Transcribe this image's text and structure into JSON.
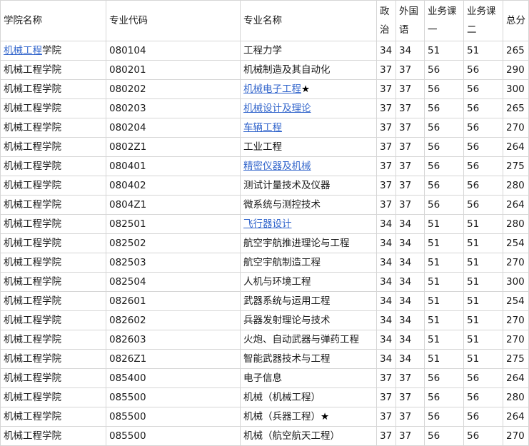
{
  "headers": {
    "college": "学院名称",
    "code": "专业代码",
    "major": "专业名称",
    "politics": "政治",
    "foreign": "外国语",
    "course1": "业务课一",
    "course2": "业务课二",
    "total": "总分"
  },
  "rows": [
    {
      "college": "机械工程",
      "college_suffix": "学院",
      "college_link": true,
      "code": "080104",
      "major": "工程力学",
      "major_link": false,
      "star": "",
      "politics": "34",
      "foreign": "34",
      "course1": "51",
      "course2": "51",
      "total": "265"
    },
    {
      "college": "机械工程学院",
      "college_suffix": "",
      "college_link": false,
      "code": "080201",
      "major": "机械制造及其自动化",
      "major_link": false,
      "star": "",
      "politics": "37",
      "foreign": "37",
      "course1": "56",
      "course2": "56",
      "total": "290"
    },
    {
      "college": "机械工程学院",
      "college_suffix": "",
      "college_link": false,
      "code": "080202",
      "major": "机械电子工程",
      "major_link": true,
      "star": "★",
      "politics": "37",
      "foreign": "37",
      "course1": "56",
      "course2": "56",
      "total": "300"
    },
    {
      "college": "机械工程学院",
      "college_suffix": "",
      "college_link": false,
      "code": "080203",
      "major": "机械设计及理论",
      "major_link": true,
      "star": "",
      "politics": "37",
      "foreign": "37",
      "course1": "56",
      "course2": "56",
      "total": "265"
    },
    {
      "college": "机械工程学院",
      "college_suffix": "",
      "college_link": false,
      "code": "080204",
      "major": "车辆工程",
      "major_link": true,
      "star": "",
      "politics": "37",
      "foreign": "37",
      "course1": "56",
      "course2": "56",
      "total": "270"
    },
    {
      "college": "机械工程学院",
      "college_suffix": "",
      "college_link": false,
      "code": "0802Z1",
      "major": "工业工程",
      "major_link": false,
      "star": "",
      "politics": "37",
      "foreign": "37",
      "course1": "56",
      "course2": "56",
      "total": "264"
    },
    {
      "college": "机械工程学院",
      "college_suffix": "",
      "college_link": false,
      "code": "080401",
      "major": "精密仪器及机械",
      "major_link": true,
      "star": "",
      "politics": "37",
      "foreign": "37",
      "course1": "56",
      "course2": "56",
      "total": "275"
    },
    {
      "college": "机械工程学院",
      "college_suffix": "",
      "college_link": false,
      "code": "080402",
      "major": "测试计量技术及仪器",
      "major_link": false,
      "star": "",
      "politics": "37",
      "foreign": "37",
      "course1": "56",
      "course2": "56",
      "total": "280"
    },
    {
      "college": "机械工程学院",
      "college_suffix": "",
      "college_link": false,
      "code": "0804Z1",
      "major": "微系统与测控技术",
      "major_link": false,
      "star": "",
      "politics": "37",
      "foreign": "37",
      "course1": "56",
      "course2": "56",
      "total": "264"
    },
    {
      "college": "机械工程学院",
      "college_suffix": "",
      "college_link": false,
      "code": "082501",
      "major": "飞行器设计",
      "major_link": true,
      "star": "",
      "politics": "34",
      "foreign": "34",
      "course1": "51",
      "course2": "51",
      "total": "280"
    },
    {
      "college": "机械工程学院",
      "college_suffix": "",
      "college_link": false,
      "code": "082502",
      "major": "航空宇航推进理论与工程",
      "major_link": false,
      "star": "",
      "politics": "34",
      "foreign": "34",
      "course1": "51",
      "course2": "51",
      "total": "254"
    },
    {
      "college": "机械工程学院",
      "college_suffix": "",
      "college_link": false,
      "code": "082503",
      "major": "航空宇航制造工程",
      "major_link": false,
      "star": "",
      "politics": "34",
      "foreign": "34",
      "course1": "51",
      "course2": "51",
      "total": "270"
    },
    {
      "college": "机械工程学院",
      "college_suffix": "",
      "college_link": false,
      "code": "082504",
      "major": "人机与环境工程",
      "major_link": false,
      "star": "",
      "politics": "34",
      "foreign": "34",
      "course1": "51",
      "course2": "51",
      "total": "300"
    },
    {
      "college": "机械工程学院",
      "college_suffix": "",
      "college_link": false,
      "code": "082601",
      "major": "武器系统与运用工程",
      "major_link": false,
      "star": "",
      "politics": "34",
      "foreign": "34",
      "course1": "51",
      "course2": "51",
      "total": "254"
    },
    {
      "college": "机械工程学院",
      "college_suffix": "",
      "college_link": false,
      "code": "082602",
      "major": "兵器发射理论与技术",
      "major_link": false,
      "star": "",
      "politics": "34",
      "foreign": "34",
      "course1": "51",
      "course2": "51",
      "total": "270"
    },
    {
      "college": "机械工程学院",
      "college_suffix": "",
      "college_link": false,
      "code": "082603",
      "major": "火炮、自动武器与弹药工程",
      "major_link": false,
      "star": "",
      "politics": "34",
      "foreign": "34",
      "course1": "51",
      "course2": "51",
      "total": "270"
    },
    {
      "college": "机械工程学院",
      "college_suffix": "",
      "college_link": false,
      "code": "0826Z1",
      "major": "智能武器技术与工程",
      "major_link": false,
      "star": "",
      "politics": "34",
      "foreign": "34",
      "course1": "51",
      "course2": "51",
      "total": "275"
    },
    {
      "college": "机械工程学院",
      "college_suffix": "",
      "college_link": false,
      "code": "085400",
      "major": "电子信息",
      "major_link": false,
      "star": "",
      "politics": "37",
      "foreign": "37",
      "course1": "56",
      "course2": "56",
      "total": "264"
    },
    {
      "college": "机械工程学院",
      "college_suffix": "",
      "college_link": false,
      "code": "085500",
      "major": "机械（机械工程）",
      "major_link": false,
      "star": "",
      "politics": "37",
      "foreign": "37",
      "course1": "56",
      "course2": "56",
      "total": "280"
    },
    {
      "college": "机械工程学院",
      "college_suffix": "",
      "college_link": false,
      "code": "085500",
      "major": "机械（兵器工程）",
      "major_link": false,
      "star": "★",
      "politics": "37",
      "foreign": "37",
      "course1": "56",
      "course2": "56",
      "total": "264"
    },
    {
      "college": "机械工程学院",
      "college_suffix": "",
      "college_link": false,
      "code": "085500",
      "major": "机械（航空航天工程）",
      "major_link": false,
      "star": "",
      "politics": "37",
      "foreign": "37",
      "course1": "56",
      "course2": "56",
      "total": "270"
    }
  ]
}
